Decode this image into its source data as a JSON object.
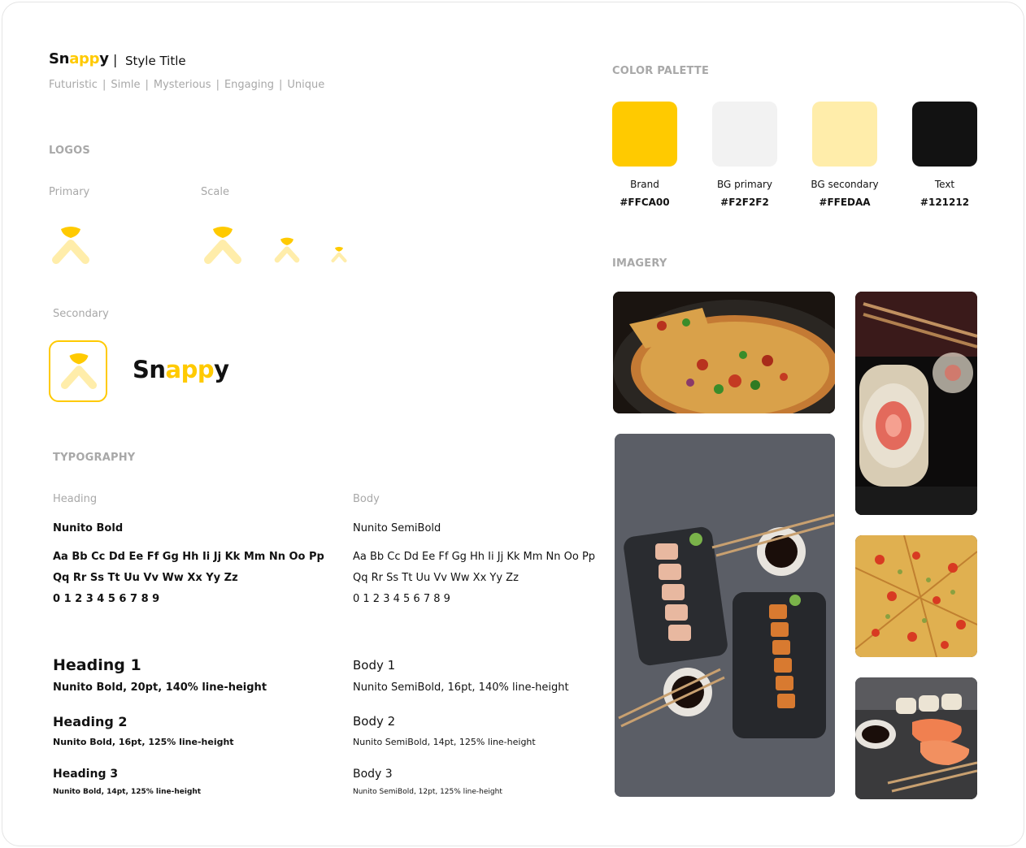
{
  "header": {
    "brand_prefix": "Sn",
    "brand_highlight": "app",
    "brand_suffix": "y",
    "separator": "|",
    "style_title": "Style Title",
    "tags": [
      "Futuristic",
      "Simle",
      "Mysterious",
      "Engaging",
      "Unique"
    ]
  },
  "logos": {
    "section_label": "LOGOS",
    "primary_label": "Primary",
    "scale_label": "Scale",
    "secondary_label": "Secondary",
    "secondary_brand_prefix": "Sn",
    "secondary_brand_highlight": "app",
    "secondary_brand_suffix": "y"
  },
  "palette": {
    "section_label": "COLOR PALETTE",
    "colors": [
      {
        "name": "Brand",
        "hex": "#FFCA00"
      },
      {
        "name": "BG primary",
        "hex": "#F2F2F2"
      },
      {
        "name": "BG secondary",
        "hex": "#FFEDAA"
      },
      {
        "name": "Text",
        "hex": "#121212"
      }
    ]
  },
  "imagery": {
    "section_label": "IMAGERY",
    "photos": [
      "pizza-pan",
      "sushi-roll-closeup",
      "sushi-platter-topdown",
      "pizza-slices",
      "salmon-nigiri"
    ]
  },
  "typography": {
    "section_label": "TYPOGRAPHY",
    "heading": {
      "label": "Heading",
      "font": "Nunito Bold",
      "glyphs_line1": "Aa Bb Cc Dd Ee Ff Gg Hh Ii Jj Kk Mm Nn Oo Pp",
      "glyphs_line2": "Qq Rr Ss Tt Uu Vv Ww Xx Yy Zz",
      "glyphs_line3": "0 1 2 3 4 5 6 7 8 9",
      "h1": "Heading 1",
      "h1_spec": "Nunito Bold, 20pt, 140% line-height",
      "h2": "Heading 2",
      "h2_spec": "Nunito Bold, 16pt, 125% line-height",
      "h3": "Heading 3",
      "h3_spec": "Nunito Bold, 14pt, 125% line-height"
    },
    "body": {
      "label": "Body",
      "font": "Nunito SemiBold",
      "glyphs_line1": "Aa Bb Cc Dd Ee Ff Gg Hh Ii Jj Kk Mm Nn Oo Pp",
      "glyphs_line2": "Qq Rr Ss Tt Uu Vv Ww Xx Yy Zz",
      "glyphs_line3": "0 1 2 3 4 5 6 7 8 9",
      "b1": "Body 1",
      "b1_spec": "Nunito SemiBold, 16pt, 140% line-height",
      "b2": "Body 2",
      "b2_spec": "Nunito SemiBold, 14pt, 125% line-height",
      "b3": "Body 3",
      "b3_spec": "Nunito SemiBold, 12pt, 125% line-height"
    }
  }
}
